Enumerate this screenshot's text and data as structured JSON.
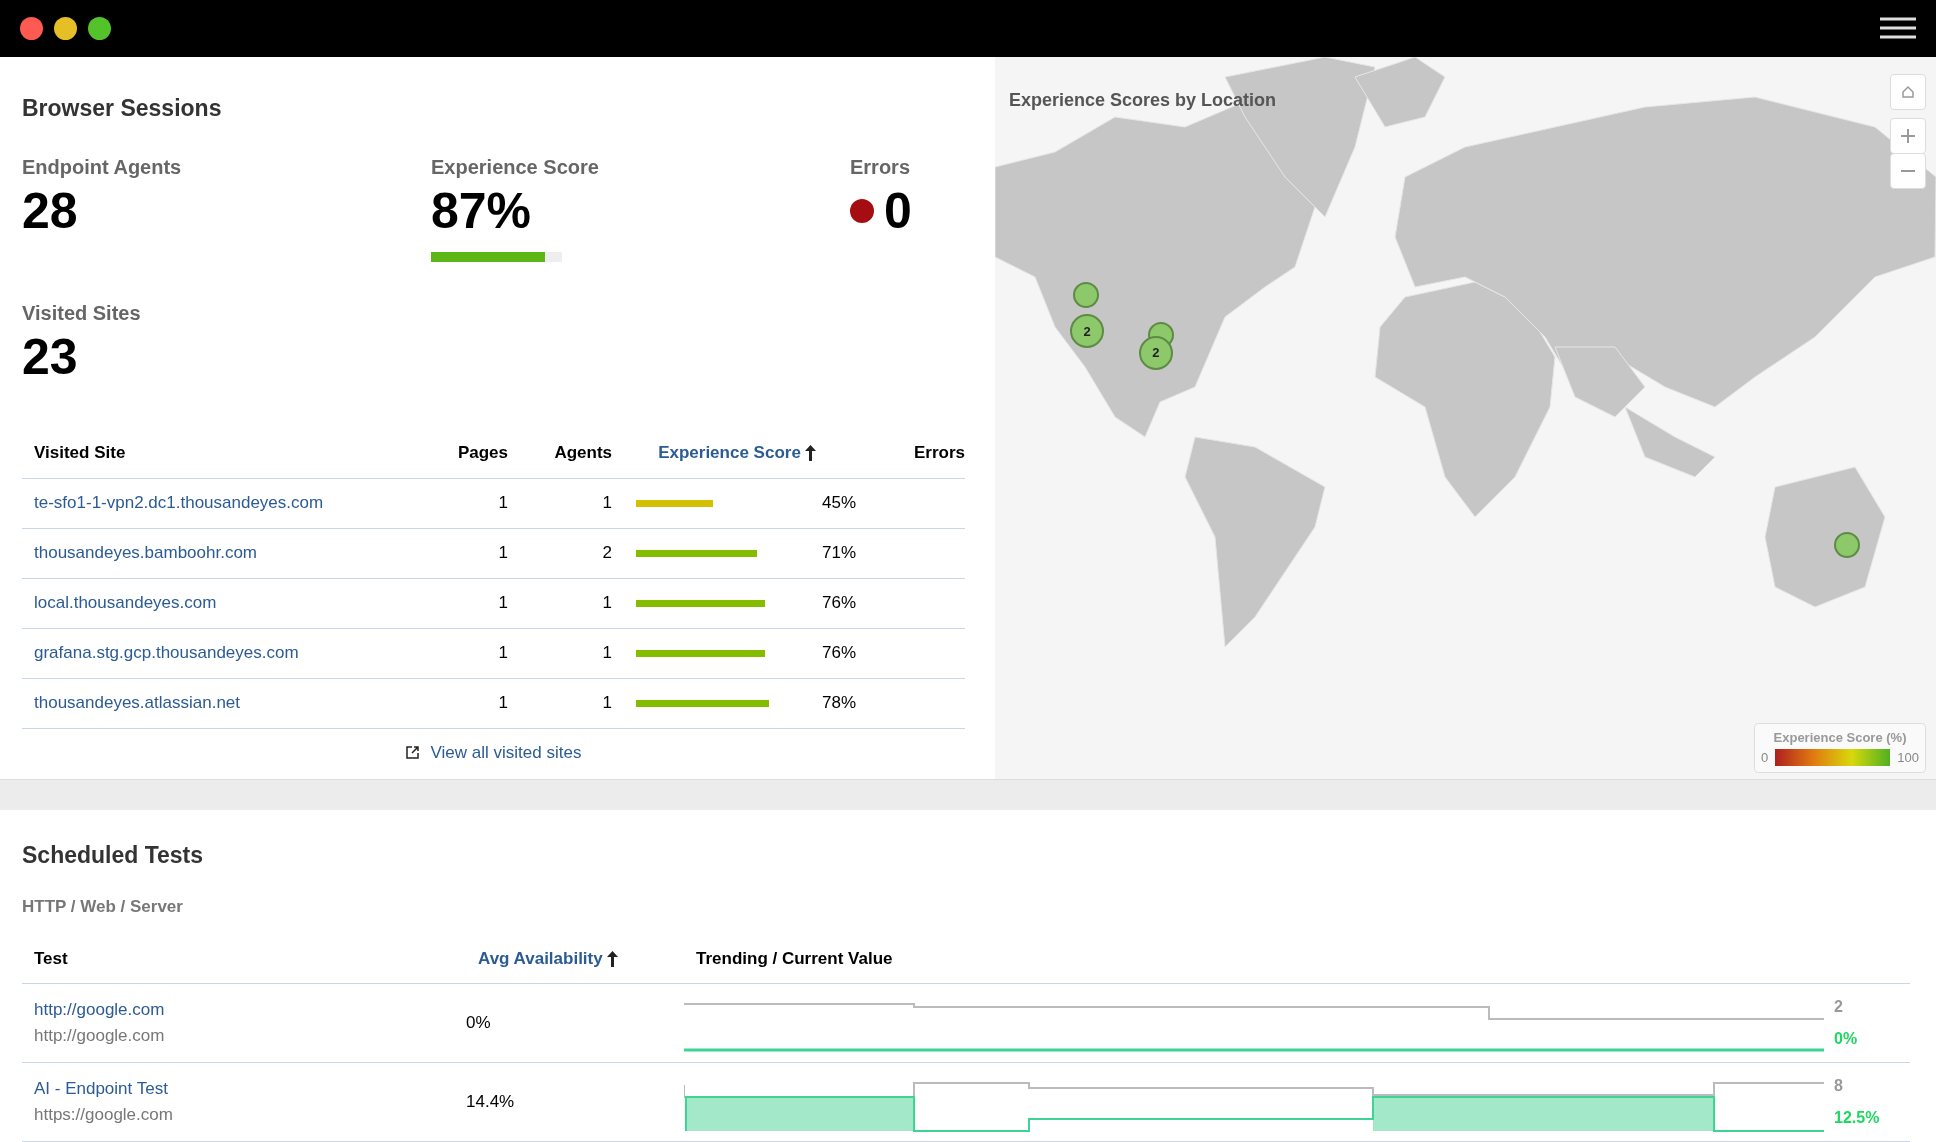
{
  "browser_sessions": {
    "title": "Browser Sessions",
    "stats": [
      {
        "label": "Endpoint Agents",
        "value": "28",
        "kind": "plain"
      },
      {
        "label": "Experience Score",
        "value": "87%",
        "kind": "meter",
        "level": 0.87
      },
      {
        "label": "Errors",
        "value": "0",
        "kind": "dot",
        "color": "#a50d12"
      },
      {
        "label": "Visited Sites",
        "value": "23",
        "kind": "plain"
      }
    ],
    "table": {
      "columns": [
        {
          "label": "Visited Site",
          "sorted": false
        },
        {
          "label": "Pages",
          "sorted": false
        },
        {
          "label": "Agents",
          "sorted": false
        },
        {
          "label": "Experience Score",
          "sorted": true
        },
        {
          "label": "Errors",
          "sorted": false
        }
      ],
      "rows": [
        {
          "site": "te-sfo1-1-vpn2.dc1.thousandeyes.com",
          "pages": "1",
          "agents": "1",
          "level": 0.45,
          "color": "#d4bf00",
          "score": "45%"
        },
        {
          "site": "thousandeyes.bamboohr.com",
          "pages": "1",
          "agents": "2",
          "level": 0.71,
          "color": "#84bd00",
          "score": "71%"
        },
        {
          "site": "local.thousandeyes.com",
          "pages": "1",
          "agents": "1",
          "level": 0.76,
          "color": "#84bd00",
          "score": "76%"
        },
        {
          "site": "grafana.stg.gcp.thousandeyes.com",
          "pages": "1",
          "agents": "1",
          "level": 0.76,
          "color": "#84bd00",
          "score": "76%"
        },
        {
          "site": "thousandeyes.atlassian.net",
          "pages": "1",
          "agents": "1",
          "level": 0.78,
          "color": "#84bd00",
          "score": "78%"
        }
      ]
    },
    "view_all_link": "View all visited sites"
  },
  "map": {
    "title": "Experience Scores by Location",
    "markers": [
      {
        "kind": "single"
      },
      {
        "kind": "cluster",
        "label": "2"
      },
      {
        "kind": "single"
      },
      {
        "kind": "cluster",
        "label": "2"
      },
      {
        "kind": "single"
      }
    ],
    "legend": {
      "title": "Experience Score (%)",
      "min": "0",
      "max": "100"
    }
  },
  "scheduled_tests": {
    "title": "Scheduled Tests",
    "subtitle": "HTTP / Web / Server",
    "columns": [
      {
        "label": "Test",
        "sorted": false
      },
      {
        "label": "Avg Availability",
        "sorted": true
      },
      {
        "label": "Trending / Current Value",
        "sorted": false
      }
    ],
    "rows": [
      {
        "name": "http://google.com",
        "url": "http://google.com",
        "availability": "0%",
        "count": "2",
        "current": "0%"
      },
      {
        "name": "AI - Endpoint Test",
        "url": "https://google.com",
        "availability": "14.4%",
        "count": "8",
        "current": "12.5%"
      }
    ]
  }
}
